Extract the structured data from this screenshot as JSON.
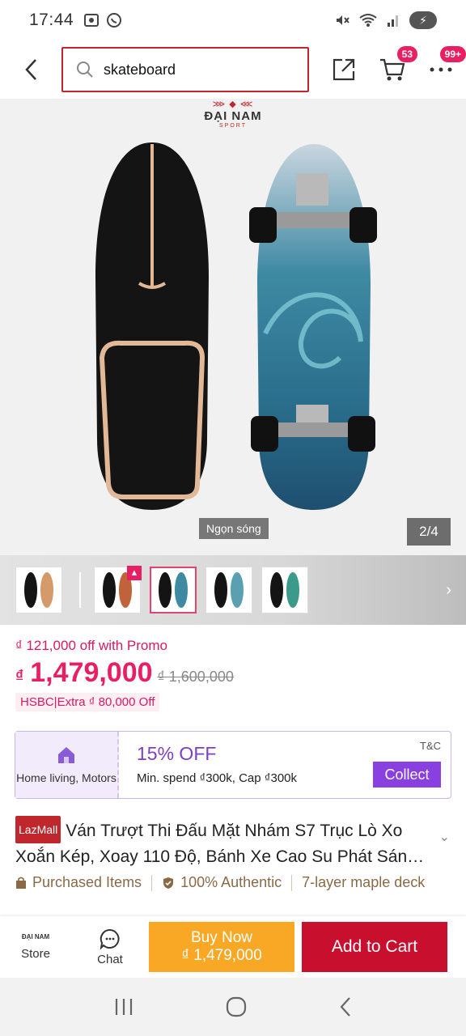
{
  "status_bar": {
    "time": "17:44",
    "left_icons": [
      "screenshot-icon",
      "whatsapp-icon"
    ],
    "right_icons": [
      "mute-icon",
      "wifi-icon",
      "signal-icon",
      "battery-charging-icon"
    ]
  },
  "top_nav": {
    "search": {
      "value": "skateboard"
    },
    "cart_badge": "53",
    "more_badge": "99+"
  },
  "gallery": {
    "brand": {
      "name": "ĐẠI NAM",
      "sub": "SPORT"
    },
    "caption": "Ngọn sóng",
    "counter": "2/4"
  },
  "price": {
    "promo": "₫ 121,000 off with Promo",
    "currency": "₫",
    "current": "1,479,000",
    "original": "₫ 1,600,000",
    "bank_offer": "HSBC|Extra ₫ 80,000 Off"
  },
  "voucher": {
    "category": "Home living, Motors",
    "title": "15% OFF",
    "description": "Min. spend ₫300k, Cap ₫300k",
    "tnc": "T&C",
    "button": "Collect"
  },
  "product": {
    "badge": "LazMall",
    "title": "Ván Trượt Thi Đấu Mặt Nhám S7 Trục Lò Xo Xoắn Kép, Xoay 110 Độ, Bánh Xe Cao Su Phát Sán…"
  },
  "features": [
    "Purchased Items",
    "100% Authentic",
    "7-layer maple deck"
  ],
  "action_bar": {
    "store_logo": "ĐẠI NAM",
    "store": "Store",
    "chat": "Chat",
    "buy_now": "Buy Now",
    "buy_now_price": "₫ 1,479,000",
    "add_to_cart": "Add to Cart"
  },
  "colors": {
    "accent_pink": "#e91e63",
    "search_border": "#c0272d",
    "voucher_purple": "#8a3fe0",
    "buy_now": "#f9a826",
    "add_to_cart": "#c8102e"
  }
}
